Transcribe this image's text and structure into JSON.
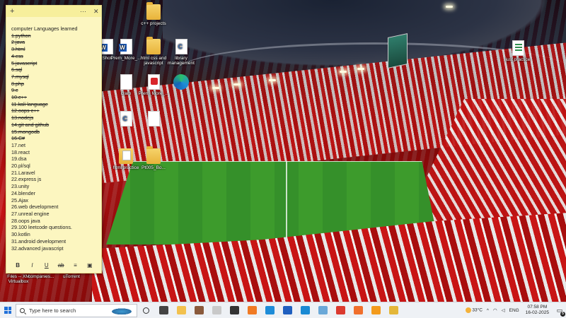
{
  "sticky_note": {
    "header": {
      "add": "+",
      "menu": "···",
      "close": "✕"
    },
    "title": "computer Languages learned",
    "items": [
      {
        "text": "1.python",
        "done": true
      },
      {
        "text": "2.java",
        "done": true
      },
      {
        "text": "3.html",
        "done": true
      },
      {
        "text": "4.css",
        "done": true
      },
      {
        "text": "5.javascript",
        "done": true
      },
      {
        "text": "6.sql",
        "done": true
      },
      {
        "text": "7.mysql",
        "done": true
      },
      {
        "text": "8.php",
        "done": true
      },
      {
        "text": "9.c",
        "done": true
      },
      {
        "text": "10.c++",
        "done": true
      },
      {
        "text": "11.kali language",
        "done": true
      },
      {
        "text": "12.oops c++",
        "done": true
      },
      {
        "text": "13.nodejs",
        "done": true
      },
      {
        "text": "14.git and github",
        "done": true
      },
      {
        "text": "15.mongodb",
        "done": true
      },
      {
        "text": "16.C#",
        "done": true
      },
      {
        "text": "17.net",
        "done": false
      },
      {
        "text": "18.react",
        "done": false
      },
      {
        "text": "19.dsa",
        "done": false
      },
      {
        "text": "20.pl/sql",
        "done": false
      },
      {
        "text": "21.Laravel",
        "done": false
      },
      {
        "text": "22.express js",
        "done": false
      },
      {
        "text": "23.unity",
        "done": false
      },
      {
        "text": "24.blender",
        "done": false
      },
      {
        "text": "25.Ajax",
        "done": false
      },
      {
        "text": "26.web development",
        "done": false
      },
      {
        "text": "27.unreal engine",
        "done": false
      },
      {
        "text": "28.oops java",
        "done": false
      },
      {
        "text": "29.100 leetcode questions.",
        "done": false
      },
      {
        "text": "30.kotlin",
        "done": false
      },
      {
        "text": "31.android development",
        "done": false
      },
      {
        "text": "32.advanced javascript",
        "done": false
      }
    ],
    "toolbar": {
      "bold": "B",
      "italic": "I",
      "underline": "U",
      "strike": "ab",
      "list": "≡",
      "image": "▣"
    }
  },
  "desktop_icons": [
    {
      "label": "c++ projects",
      "icon": "folder"
    },
    {
      "label": "",
      "icon": "word"
    },
    {
      "label": "Prem_More_...",
      "icon": "word"
    },
    {
      "label": "html css and javascript",
      "icon": "folder"
    },
    {
      "label": "library management",
      "icon": "code"
    },
    {
      "label": "just practice",
      "icon": "sheet"
    },
    {
      "label": "Prem_More_...",
      "icon": "pdf"
    },
    {
      "label": "",
      "icon": "edge"
    },
    {
      "label": "",
      "icon": "doc"
    },
    {
      "label": "",
      "icon": "code"
    },
    {
      "label": "",
      "icon": "doc"
    },
    {
      "label": "",
      "icon": "folder-doc"
    },
    {
      "label": "",
      "icon": "folder"
    }
  ],
  "desktop_fragments": {
    "left_bottom_1": "Files -- XM",
    "left_bottom_2": "companies...",
    "left_bottom_3": "uTorrent",
    "left_bottom_4": "Virtualbox",
    "mid_1": "Shot",
    "mid_2": "cram",
    "mid_3": "Prem_More_",
    "mid_4": "html practice",
    "mid_5": "Pt005_Bo..."
  },
  "taskbar": {
    "search_placeholder": "Type here to search",
    "apps": [
      {
        "name": "task-view",
        "glyph": "⊞",
        "color": "#444444"
      },
      {
        "name": "file-explorer",
        "glyph": "",
        "color": "#f2c14e"
      },
      {
        "name": "photo-app",
        "glyph": "",
        "color": "#8a5a3c"
      },
      {
        "name": "notes-app",
        "glyph": "",
        "color": "#c9c9c9"
      },
      {
        "name": "terminal",
        "glyph": "",
        "color": "#333333"
      },
      {
        "name": "xampp",
        "glyph": "",
        "color": "#f07a24"
      },
      {
        "name": "edge-browser",
        "glyph": "",
        "color": "#1e8cd8"
      },
      {
        "name": "virtualbox",
        "glyph": "",
        "color": "#1f5fbf"
      },
      {
        "name": "vscode",
        "glyph": "",
        "color": "#1a8ad4"
      },
      {
        "name": "file-manager-blue",
        "glyph": "",
        "color": "#6aa8d8"
      },
      {
        "name": "chrome",
        "glyph": "",
        "color": "#db3a2f"
      },
      {
        "name": "brave",
        "glyph": "",
        "color": "#f06f2c"
      },
      {
        "name": "sublime",
        "glyph": "",
        "color": "#f39b1d"
      },
      {
        "name": "media-app",
        "glyph": "",
        "color": "#e4b73a"
      }
    ],
    "weather": "33°C",
    "language": "ENG",
    "time": "07:58 PM",
    "date": "16-02-2025",
    "notification_count": "5"
  }
}
